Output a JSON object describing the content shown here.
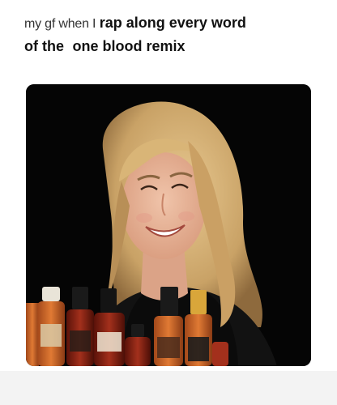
{
  "caption": {
    "part1": "my gf when I",
    "part2": "rap along every word",
    "part3": "of the",
    "part4": "one blood remix"
  },
  "image": {
    "description_icon": "photo-of-smiling-woman-with-hot-sauces"
  },
  "colors": {
    "background": "#ffffff",
    "photo_background": "#050505",
    "hair": "#d8b47a",
    "skin": "#e9b79c",
    "sauce_orange": "#c9682c",
    "sauce_red": "#8c2416"
  }
}
